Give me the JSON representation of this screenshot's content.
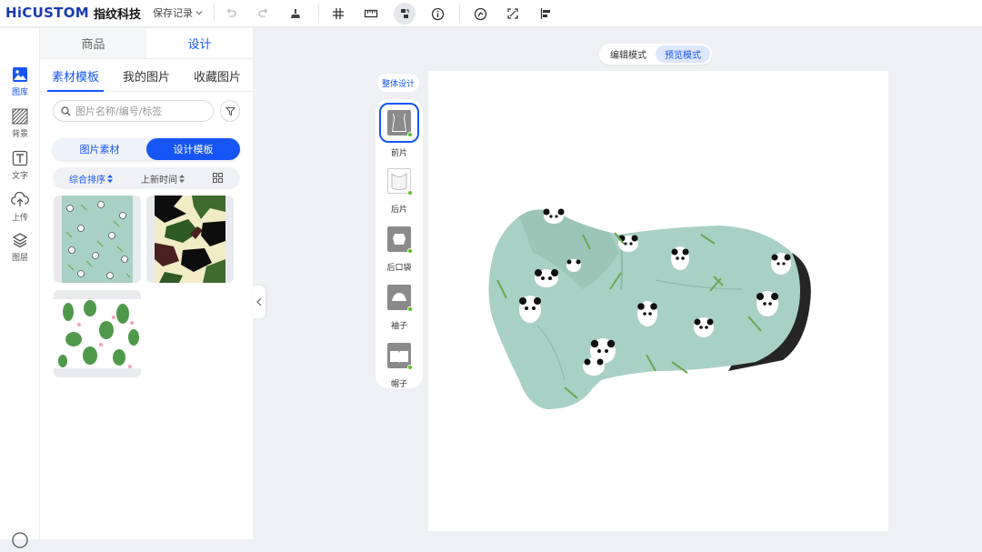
{
  "brand": {
    "name_en": "HiCUSTOM",
    "name_cn": "指纹科技"
  },
  "toolbar": {
    "save_record": "保存记录",
    "icons": [
      "undo-icon",
      "redo-icon",
      "clean-icon",
      "grid-icon",
      "ruler-icon",
      "layers-toggle-icon",
      "info-icon",
      "gauge-icon",
      "fullscreen-icon",
      "align-icon"
    ]
  },
  "rail": {
    "items": [
      {
        "label": "图库",
        "icon": "image-icon"
      },
      {
        "label": "背景",
        "icon": "background-icon"
      },
      {
        "label": "文字",
        "icon": "text-icon"
      },
      {
        "label": "上传",
        "icon": "upload-icon"
      },
      {
        "label": "图层",
        "icon": "layers-icon"
      }
    ]
  },
  "panel": {
    "top_tabs": [
      "商品",
      "设计"
    ],
    "sub_tabs": [
      "素材模板",
      "我的图片",
      "收藏图片"
    ],
    "search": {
      "placeholder": "图片名称/编号/标签"
    },
    "segments": [
      "图片素材",
      "设计模板"
    ],
    "sort": {
      "primary": "综合排序",
      "secondary": "上新时间"
    },
    "thumbnails": [
      {
        "name": "panda-bamboo-pattern"
      },
      {
        "name": "camouflage-pattern"
      },
      {
        "name": "cactus-pattern"
      }
    ]
  },
  "modes": [
    "编辑模式",
    "预览模式"
  ],
  "whole_design": "整体设计",
  "parts": [
    {
      "label": "前片"
    },
    {
      "label": "后片"
    },
    {
      "label": "后口袋"
    },
    {
      "label": "袖子"
    },
    {
      "label": "帽子"
    }
  ],
  "colors": {
    "accent": "#1656f5",
    "fabric": "#a9d0c4",
    "status_dot": "#52c41a"
  }
}
